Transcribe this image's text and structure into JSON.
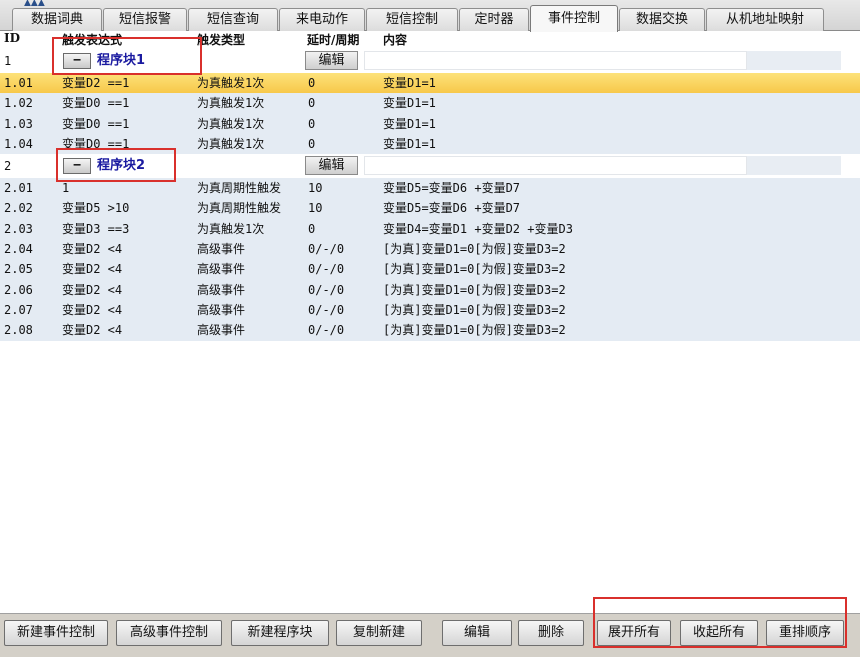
{
  "tabs": [
    {
      "label": "数据词典"
    },
    {
      "label": "短信报警"
    },
    {
      "label": "短信查询"
    },
    {
      "label": "来电动作"
    },
    {
      "label": "短信控制"
    },
    {
      "label": "定时器"
    },
    {
      "label": "事件控制",
      "active": true
    },
    {
      "label": "数据交换"
    },
    {
      "label": "从机地址映射"
    }
  ],
  "columns": {
    "id": "ID",
    "expr": "触发表达式",
    "type": "触发类型",
    "delay": "延时/周期",
    "content": "内容"
  },
  "groups": [
    {
      "id": "1",
      "toggle": "−",
      "name": "程序块1",
      "edit_label": "编辑",
      "rows": [
        {
          "id": "1.01",
          "expr": "变量D2 ==1",
          "type": "为真触发1次",
          "delay": "0",
          "content": "变量D1=1",
          "selected": true
        },
        {
          "id": "1.02",
          "expr": "变量D0 ==1",
          "type": "为真触发1次",
          "delay": "0",
          "content": "变量D1=1"
        },
        {
          "id": "1.03",
          "expr": "变量D0 ==1",
          "type": "为真触发1次",
          "delay": "0",
          "content": "变量D1=1"
        },
        {
          "id": "1.04",
          "expr": "变量D0 ==1",
          "type": "为真触发1次",
          "delay": "0",
          "content": "变量D1=1"
        }
      ]
    },
    {
      "id": "2",
      "toggle": "−",
      "name": "程序块2",
      "edit_label": "编辑",
      "rows": [
        {
          "id": "2.01",
          "expr": "1",
          "type": "为真周期性触发",
          "delay": "10",
          "content": "变量D5=变量D6 +变量D7"
        },
        {
          "id": "2.02",
          "expr": "变量D5 >10",
          "type": "为真周期性触发",
          "delay": "10",
          "content": "变量D5=变量D6 +变量D7"
        },
        {
          "id": "2.03",
          "expr": "变量D3 ==3",
          "type": "为真触发1次",
          "delay": "0",
          "content": "变量D4=变量D1 +变量D2 +变量D3"
        },
        {
          "id": "2.04",
          "expr": "变量D2 <4",
          "type": "高级事件",
          "delay": "0/-/0",
          "content": "[为真]变量D1=0[为假]变量D3=2"
        },
        {
          "id": "2.05",
          "expr": "变量D2 <4",
          "type": "高级事件",
          "delay": "0/-/0",
          "content": "[为真]变量D1=0[为假]变量D3=2"
        },
        {
          "id": "2.06",
          "expr": "变量D2 <4",
          "type": "高级事件",
          "delay": "0/-/0",
          "content": "[为真]变量D1=0[为假]变量D3=2"
        },
        {
          "id": "2.07",
          "expr": "变量D2 <4",
          "type": "高级事件",
          "delay": "0/-/0",
          "content": "[为真]变量D1=0[为假]变量D3=2"
        },
        {
          "id": "2.08",
          "expr": "变量D2 <4",
          "type": "高级事件",
          "delay": "0/-/0",
          "content": "[为真]变量D1=0[为假]变量D3=2"
        }
      ]
    }
  ],
  "toolbar": {
    "new_event": "新建事件控制",
    "new_advanced": "高级事件控制",
    "new_block": "新建程序块",
    "copy_new": "复制新建",
    "edit": "编辑",
    "delete": "删除",
    "expand_all": "展开所有",
    "collapse_all": "收起所有",
    "reorder": "重排顺序"
  },
  "colors": {
    "selected_row": "#f7c84a",
    "row_bg": "#e4ebf3",
    "group_name": "#1a1aa0",
    "highlight_box": "#d9302c"
  }
}
